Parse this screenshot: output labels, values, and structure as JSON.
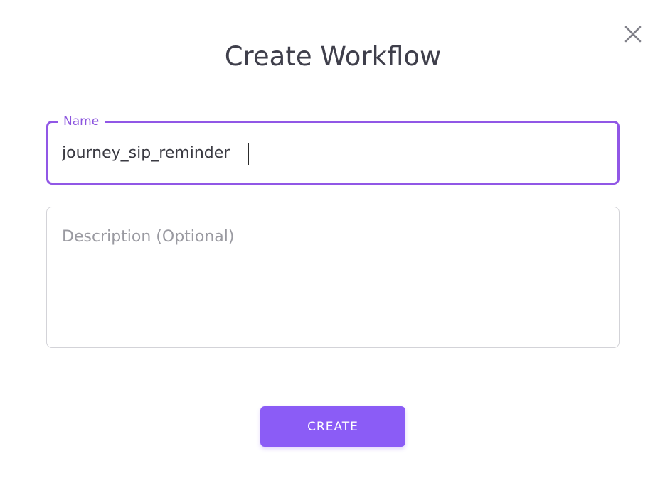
{
  "dialog": {
    "title": "Create Workflow",
    "close_icon": "close-icon"
  },
  "form": {
    "name": {
      "label": "Name",
      "value": "journey_sip_reminder"
    },
    "description": {
      "value": "",
      "placeholder": "Description (Optional)"
    },
    "submit_label": "CREATE"
  },
  "colors": {
    "accent": "#8b5cf6",
    "focus_border": "#9157e6",
    "title_text": "#3f3f4b",
    "placeholder_text": "#9a9aa1",
    "idle_border": "#d3d3d8"
  }
}
